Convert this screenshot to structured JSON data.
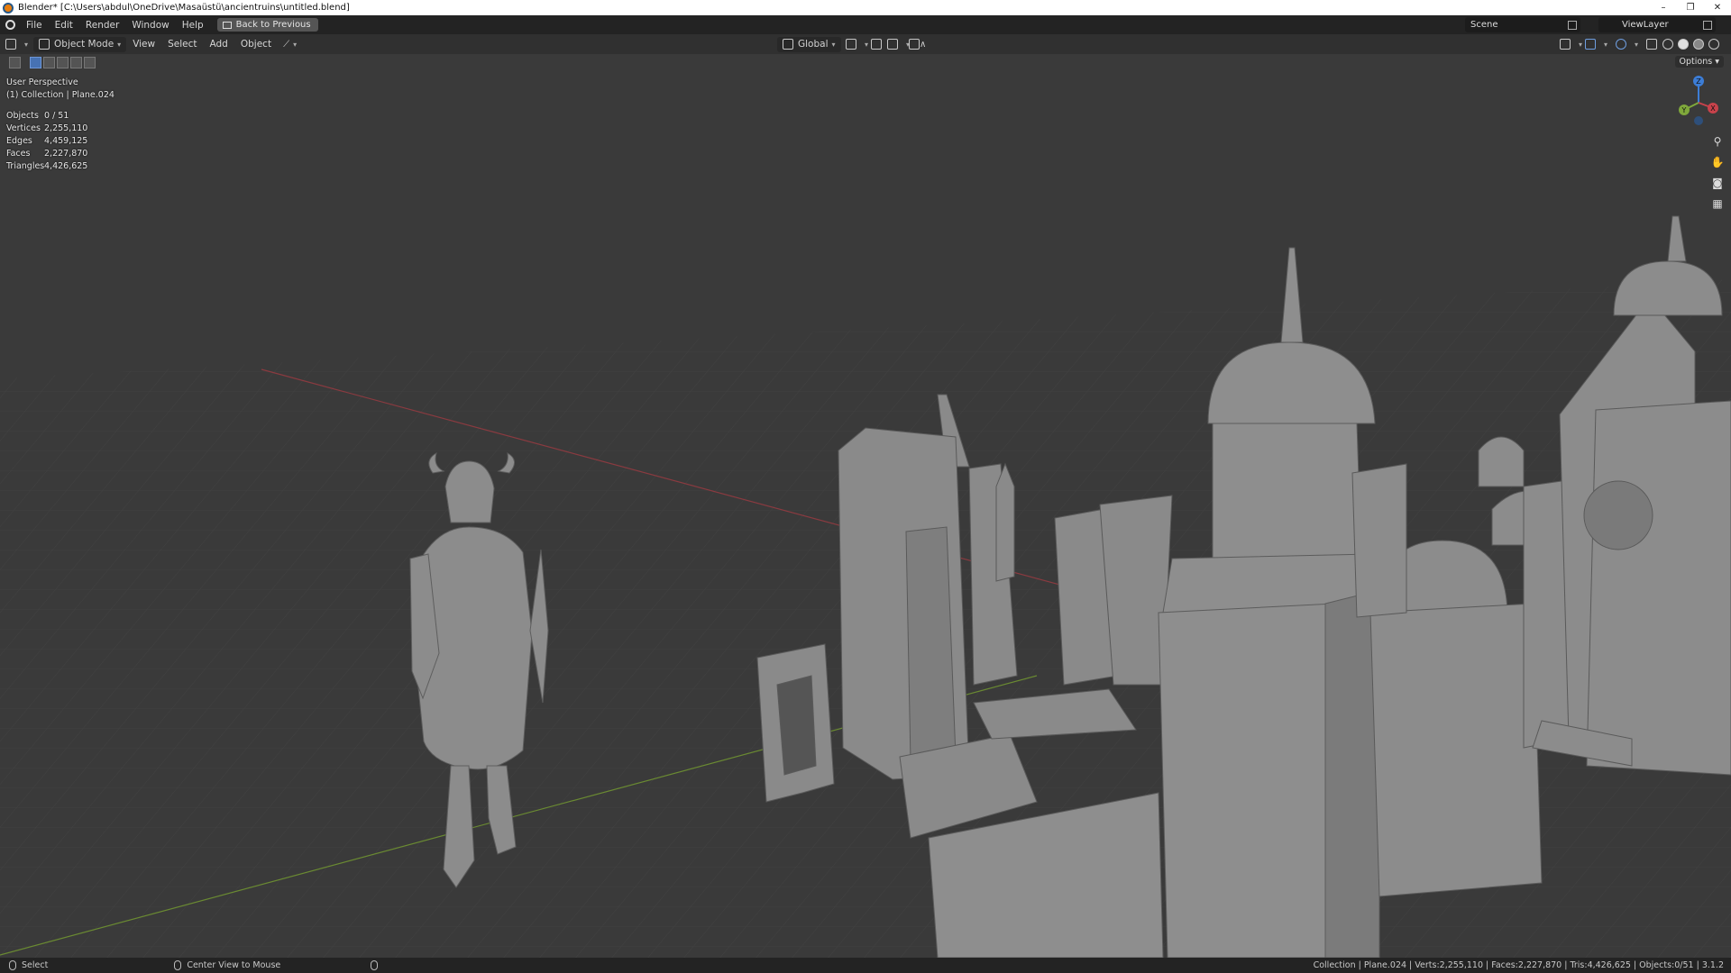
{
  "window": {
    "title": "Blender* [C:\\Users\\abdul\\OneDrive\\Masaüstü\\ancientruins\\untitled.blend]",
    "controls": [
      "–",
      "❐",
      "✕"
    ]
  },
  "menubar": {
    "items": [
      "File",
      "Edit",
      "Render",
      "Window",
      "Help"
    ],
    "back_button": "Back to Previous",
    "scene_label": "Scene",
    "view_layer_label": "ViewLayer"
  },
  "viewport_header": {
    "mode": "Object Mode",
    "menus": [
      "View",
      "Select",
      "Add",
      "Object"
    ],
    "transform_orientation": "Global",
    "options_label": "Options"
  },
  "overlay": {
    "perspective": "User Perspective",
    "collection": "(1) Collection | Plane.024",
    "stats": [
      {
        "label": "Objects",
        "value": "0 / 51"
      },
      {
        "label": "Vertices",
        "value": "2,255,110"
      },
      {
        "label": "Edges",
        "value": "4,459,125"
      },
      {
        "label": "Faces",
        "value": "2,227,870"
      },
      {
        "label": "Triangles",
        "value": "4,426,625"
      }
    ],
    "gizmo_axes": [
      "Z",
      "Y",
      "X"
    ]
  },
  "statusbar": {
    "select": "Select",
    "center_view": "Center View to Mouse",
    "info": "Collection | Plane.024 | Verts:2,255,110 | Faces:2,227,870 | Tris:4,426,625 | Objects:0/51 | 3.1.2"
  },
  "colors": {
    "accent": "#4772b3",
    "x_axis": "#c8424b",
    "y_axis": "#7fa83b",
    "z_axis": "#3c7dd6",
    "grid_line": "#444444",
    "mesh_fill": "#8e8e8e"
  }
}
